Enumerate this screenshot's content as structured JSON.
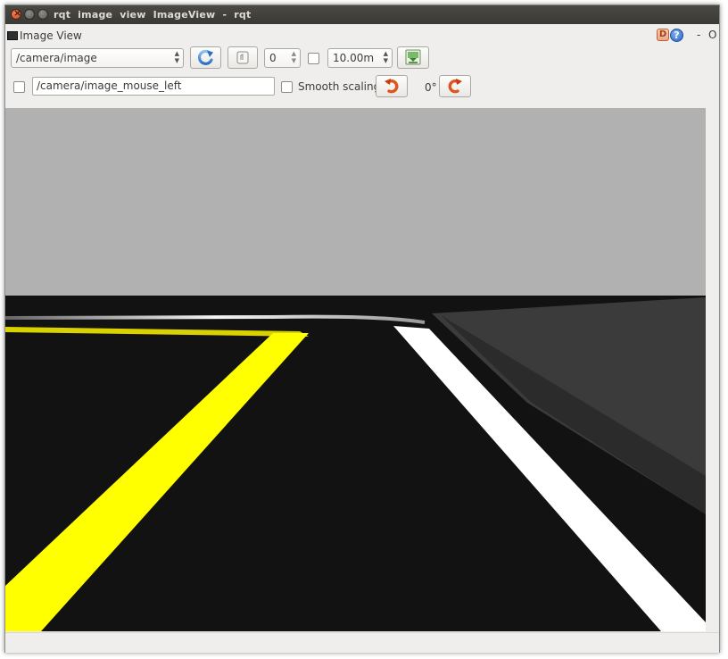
{
  "window": {
    "title": "rqt  image  view   ImageView - rqt"
  },
  "plugin": {
    "title": "Image View",
    "help_d_label": "D",
    "help_label": "?",
    "dash_label": "-",
    "o_label": "O"
  },
  "toolbar": {
    "topic": "/camera/image",
    "spin_value": "0",
    "time_value": "10.00m",
    "mouse_topic": "/camera/image_mouse_left",
    "smooth_scaling_label": "Smooth scaling",
    "rotation_label": "0°"
  },
  "icons": {
    "refresh": "refresh-icon",
    "zoom": "zoom-fit-icon",
    "save": "save-image-icon",
    "rotate_left": "rotate-left-icon",
    "rotate_right": "rotate-right-icon"
  },
  "colors": {
    "sky": "#b1b1b1",
    "road": "#121212",
    "yellow_line": "#ffff00",
    "white_line": "#ffffff",
    "accent_orange": "#e0531f"
  }
}
